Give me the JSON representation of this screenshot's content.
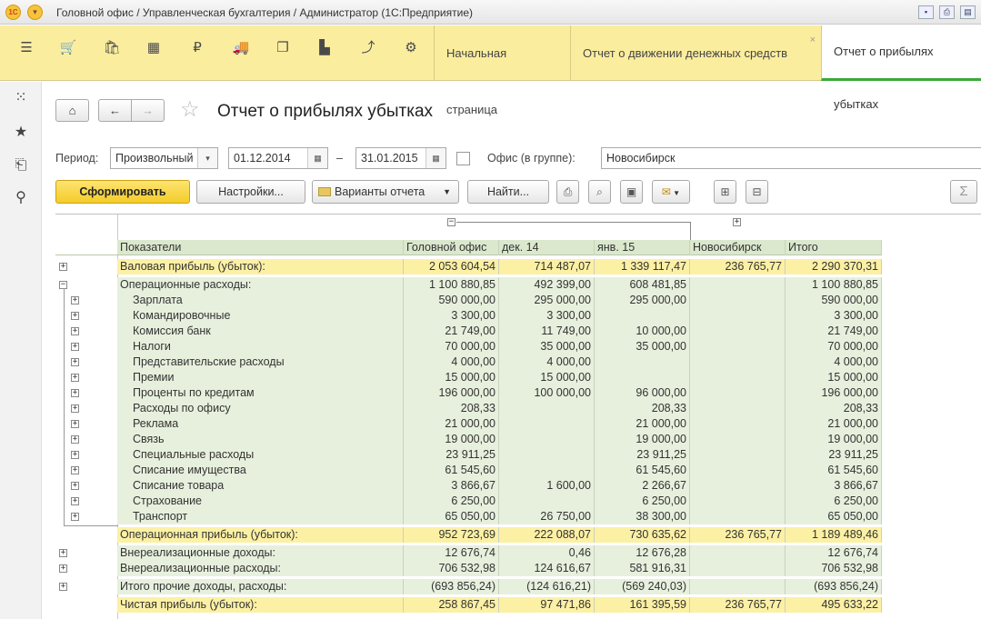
{
  "window": {
    "title": "Головной офис / Управленческая бухгалтерия / Администратор  (1С:Предприятие)",
    "logo_text": "1C"
  },
  "sections": [
    {
      "icon": "menu-icon",
      "glyph": "☰"
    },
    {
      "icon": "cart-icon",
      "glyph": "🛒"
    },
    {
      "icon": "bag-icon",
      "glyph": "🛍"
    },
    {
      "icon": "grid-icon",
      "glyph": "▦"
    },
    {
      "icon": "ruble-icon",
      "glyph": "₽"
    },
    {
      "icon": "truck-icon",
      "glyph": "🚚"
    },
    {
      "icon": "documents-icon",
      "glyph": "❐"
    },
    {
      "icon": "bar-chart-icon",
      "glyph": "▙"
    },
    {
      "icon": "trend-icon",
      "glyph": "⤴"
    },
    {
      "icon": "gear-icon",
      "glyph": "⚙"
    }
  ],
  "tabs": [
    {
      "label": "Начальная страница"
    },
    {
      "label": "Отчет о движении денежных средств",
      "close": "×"
    },
    {
      "label": "Отчет о прибылях убытках"
    }
  ],
  "leftbar": [
    {
      "icon": "apps-icon",
      "glyph": "⁙"
    },
    {
      "icon": "favorites-icon",
      "glyph": "★"
    },
    {
      "icon": "history-icon",
      "glyph": "⎗"
    },
    {
      "icon": "search-icon",
      "glyph": "⚲"
    }
  ],
  "nav": {
    "home": "⌂",
    "back": "←",
    "forward": "→",
    "star": "☆"
  },
  "page_title": "Отчет о прибылях убытках",
  "filters": {
    "period_label": "Период:",
    "period_type": "Произвольный",
    "date_from": "01.12.2014",
    "dash": "–",
    "date_to": "31.01.2015",
    "office_label": "Офис (в группе):",
    "office_value": "Новосибирск",
    "dropdown_glyph": "▾",
    "calendar_glyph": "▦"
  },
  "toolbar": {
    "generate": "Сформировать",
    "settings": "Настройки...",
    "variants": "Варианты отчета",
    "find": "Найти...",
    "sum_glyph": "Σ"
  },
  "columns": [
    "Показатели",
    "Головной офис",
    "дек. 14",
    "янв. 15",
    "Новосибирск",
    "Итого"
  ],
  "rows": [
    {
      "label": "Валовая прибыль (убыток):",
      "v": [
        "2 053 604,54",
        "714 487,07",
        "1 339 117,47",
        "236 765,77",
        "2 290 370,31"
      ],
      "style": "y",
      "sub": false,
      "pm": "+",
      "gap": true
    },
    {
      "label": "Операционные расходы:",
      "v": [
        "1 100 880,85",
        "492 399,00",
        "608 481,85",
        "",
        "1 100 880,85"
      ],
      "style": "g",
      "sub": false,
      "pm": "−",
      "gap": true
    },
    {
      "label": "Зарплата",
      "v": [
        "590 000,00",
        "295 000,00",
        "295 000,00",
        "",
        "590 000,00"
      ],
      "style": "g",
      "sub": true,
      "pm": "+"
    },
    {
      "label": "Командировочные",
      "v": [
        "3 300,00",
        "3 300,00",
        "",
        "",
        "3 300,00"
      ],
      "style": "g",
      "sub": true,
      "pm": "+"
    },
    {
      "label": "Комиссия банк",
      "v": [
        "21 749,00",
        "11 749,00",
        "10 000,00",
        "",
        "21 749,00"
      ],
      "style": "g",
      "sub": true,
      "pm": "+"
    },
    {
      "label": "Налоги",
      "v": [
        "70 000,00",
        "35 000,00",
        "35 000,00",
        "",
        "70 000,00"
      ],
      "style": "g",
      "sub": true,
      "pm": "+"
    },
    {
      "label": "Представительские расходы",
      "v": [
        "4 000,00",
        "4 000,00",
        "",
        "",
        "4 000,00"
      ],
      "style": "g",
      "sub": true,
      "pm": "+"
    },
    {
      "label": "Премии",
      "v": [
        "15 000,00",
        "15 000,00",
        "",
        "",
        "15 000,00"
      ],
      "style": "g",
      "sub": true,
      "pm": "+"
    },
    {
      "label": "Проценты по кредитам",
      "v": [
        "196 000,00",
        "100 000,00",
        "96 000,00",
        "",
        "196 000,00"
      ],
      "style": "g",
      "sub": true,
      "pm": "+"
    },
    {
      "label": "Расходы по офису",
      "v": [
        "208,33",
        "",
        "208,33",
        "",
        "208,33"
      ],
      "style": "g",
      "sub": true,
      "pm": "+"
    },
    {
      "label": "Реклама",
      "v": [
        "21 000,00",
        "",
        "21 000,00",
        "",
        "21 000,00"
      ],
      "style": "g",
      "sub": true,
      "pm": "+"
    },
    {
      "label": "Связь",
      "v": [
        "19 000,00",
        "",
        "19 000,00",
        "",
        "19 000,00"
      ],
      "style": "g",
      "sub": true,
      "pm": "+"
    },
    {
      "label": "Специальные расходы",
      "v": [
        "23 911,25",
        "",
        "23 911,25",
        "",
        "23 911,25"
      ],
      "style": "g",
      "sub": true,
      "pm": "+"
    },
    {
      "label": "Списание имущества",
      "v": [
        "61 545,60",
        "",
        "61 545,60",
        "",
        "61 545,60"
      ],
      "style": "g",
      "sub": true,
      "pm": "+"
    },
    {
      "label": "Списание товара",
      "v": [
        "3 866,67",
        "1 600,00",
        "2 266,67",
        "",
        "3 866,67"
      ],
      "style": "g",
      "sub": true,
      "pm": "+"
    },
    {
      "label": "Страхование",
      "v": [
        "6 250,00",
        "",
        "6 250,00",
        "",
        "6 250,00"
      ],
      "style": "g",
      "sub": true,
      "pm": "+"
    },
    {
      "label": "Транспорт",
      "v": [
        "65 050,00",
        "26 750,00",
        "38 300,00",
        "",
        "65 050,00"
      ],
      "style": "g",
      "sub": true,
      "pm": "+"
    },
    {
      "label": "Операционная прибыль (убыток):",
      "v": [
        "952 723,69",
        "222 088,07",
        "730 635,62",
        "236 765,77",
        "1 189 489,46"
      ],
      "style": "y",
      "sub": false,
      "pm": "",
      "gap": true
    },
    {
      "label": "Внереализационные доходы:",
      "v": [
        "12 676,74",
        "0,46",
        "12 676,28",
        "",
        "12 676,74"
      ],
      "style": "g",
      "sub": false,
      "pm": "+",
      "gap": true
    },
    {
      "label": "Внереализационные расходы:",
      "v": [
        "706 532,98",
        "124 616,67",
        "581 916,31",
        "",
        "706 532,98"
      ],
      "style": "g",
      "sub": false,
      "pm": "+"
    },
    {
      "label": "Итого прочие доходы, расходы:",
      "v": [
        "(693 856,24)",
        "(124 616,21)",
        "(569 240,03)",
        "",
        "(693 856,24)"
      ],
      "style": "g",
      "sub": false,
      "pm": "+",
      "gap": true
    },
    {
      "label": "Чистая прибыль (убыток):",
      "v": [
        "258 867,45",
        "97 471,86",
        "161 395,59",
        "236 765,77",
        "495 633,22"
      ],
      "style": "y",
      "sub": false,
      "pm": "",
      "gap": true
    }
  ]
}
